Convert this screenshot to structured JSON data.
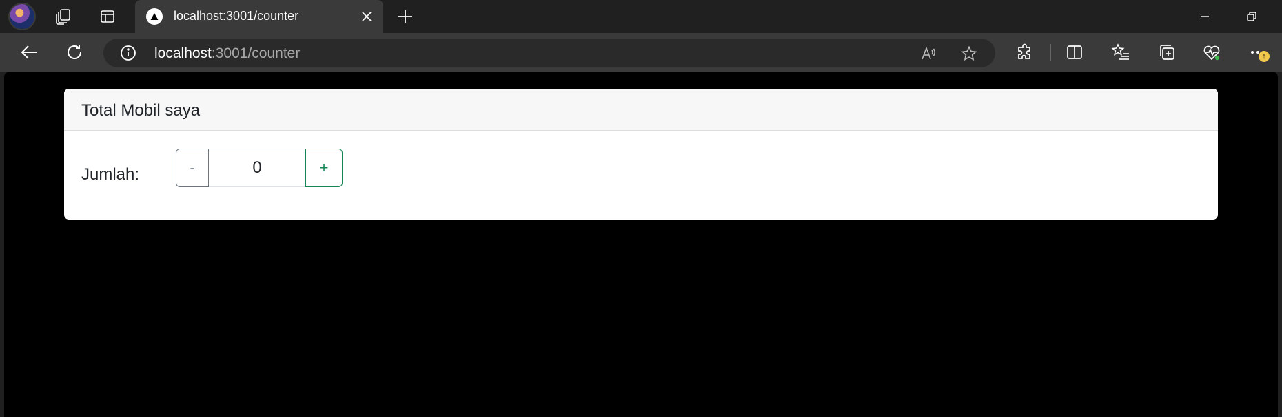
{
  "browser": {
    "tab": {
      "title": "localhost:3001/counter"
    },
    "address": {
      "host": "localhost",
      "rest": ":3001/counter"
    },
    "notification_badge": "↑"
  },
  "page": {
    "card_title": "Total Mobil saya",
    "quantity_label": "Jumlah:",
    "decrement_label": "-",
    "quantity_value": "0",
    "increment_label": "+"
  },
  "colors": {
    "accent_green": "#198754",
    "secondary_gray": "#6c757d"
  }
}
